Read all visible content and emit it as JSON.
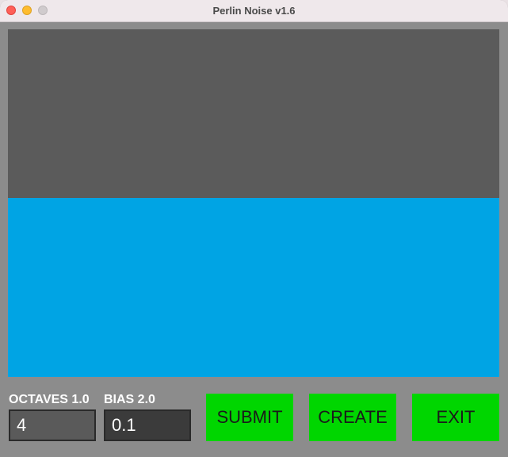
{
  "window": {
    "title": "Perlin Noise v1.6"
  },
  "canvas": {
    "upper_color": "#5b5b5b",
    "lower_color": "#00a4e4"
  },
  "controls": {
    "octaves": {
      "label": "OCTAVES 1.0",
      "value": "4"
    },
    "bias": {
      "label": "BIAS 2.0",
      "value": "0.1"
    },
    "submit_label": "SUBMIT",
    "create_label": "CREATE",
    "exit_label": "EXIT",
    "button_color": "#00d600"
  }
}
